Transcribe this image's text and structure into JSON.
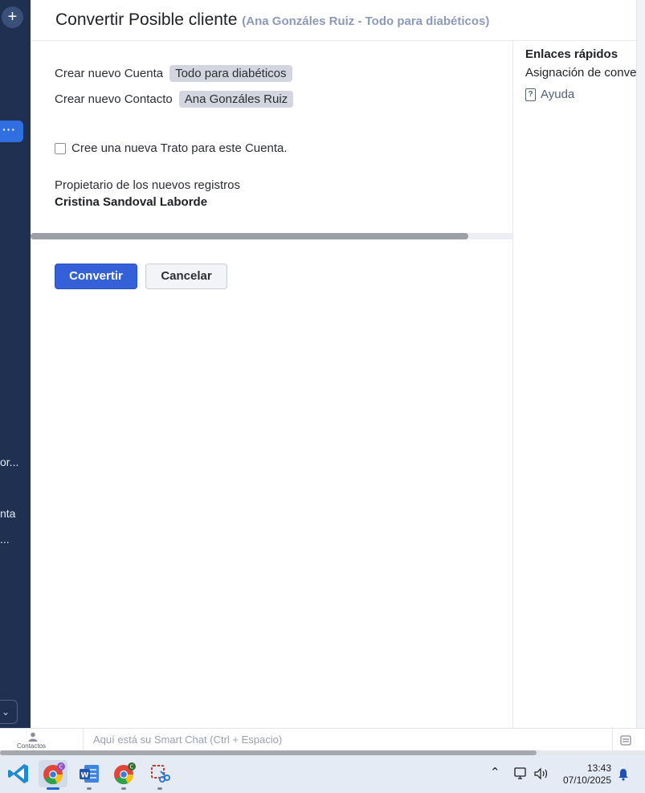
{
  "sidebar": {
    "items": [
      {
        "label": "or..."
      },
      {
        "label": "nta"
      },
      {
        "label": "..."
      }
    ]
  },
  "header": {
    "title": "Convertir Posible cliente",
    "subtitle": "(Ana Gonzáles Ruiz - Todo para diabéticos)"
  },
  "form": {
    "account_label": "Crear nuevo Cuenta",
    "account_value": "Todo para diabéticos",
    "contact_label": "Crear nuevo Contacto",
    "contact_value": "Ana Gonzáles Ruiz",
    "deal_checkbox_label": "Cree una nueva Trato para este Cuenta.",
    "deal_checked": false,
    "owner_label": "Propietario de los nuevos registros",
    "owner_name": "Cristina Sandoval Laborde",
    "convert_label": "Convertir",
    "cancel_label": "Cancelar"
  },
  "quick_links": {
    "title": "Enlaces rápidos",
    "link": "Asignación de conver",
    "help": "Ayuda"
  },
  "chatbar": {
    "contacts_label": "Contactos",
    "placeholder": "Aquí está su Smart Chat (Ctrl + Espacio)"
  },
  "taskbar": {
    "time": "13:43",
    "date": "07/10/2025",
    "apps": [
      "vscode-icon",
      "chrome-icon",
      "word-icon",
      "chrome-icon",
      "snipping-tool-icon"
    ]
  },
  "colors": {
    "sidebar": "#1f3050",
    "primary": "#3461d8",
    "subtitle": "#8c9ab8"
  }
}
